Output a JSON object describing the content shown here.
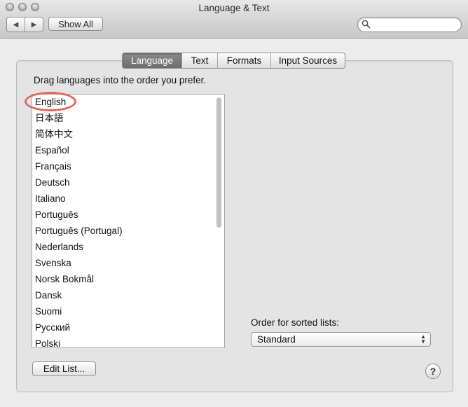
{
  "window": {
    "title": "Language & Text"
  },
  "toolbar": {
    "back_icon": "back-arrow",
    "forward_icon": "forward-arrow",
    "show_all_label": "Show All",
    "search_value": ""
  },
  "tabs": [
    {
      "label": "Language",
      "active": true
    },
    {
      "label": "Text",
      "active": false
    },
    {
      "label": "Formats",
      "active": false
    },
    {
      "label": "Input Sources",
      "active": false
    }
  ],
  "language_panel": {
    "instruction": "Drag languages into the order you prefer.",
    "languages": [
      "English",
      "日本語",
      "简体中文",
      "Español",
      "Français",
      "Deutsch",
      "Italiano",
      "Português",
      "Português (Portugal)",
      "Nederlands",
      "Svenska",
      "Norsk Bokmål",
      "Dansk",
      "Suomi",
      "Русский",
      "Polski"
    ],
    "highlighted_language": "English",
    "highlight_color": "#e0675a",
    "order_label": "Order for sorted lists:",
    "order_value": "Standard",
    "edit_list_label": "Edit List...",
    "help_label": "?"
  }
}
